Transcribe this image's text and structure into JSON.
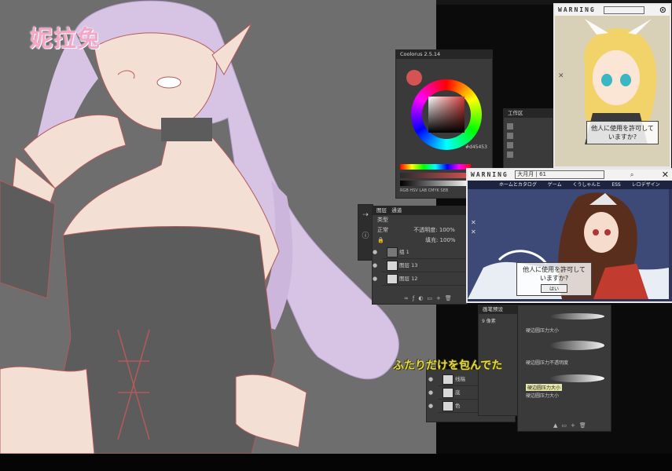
{
  "canvas": {
    "logo_text": "妮拉兔"
  },
  "color_panel": {
    "title": "Coolorus 2.5.14",
    "hex_value": "#d45453",
    "footer_items": [
      "RGB",
      "HSV",
      "LAB",
      "CMYK",
      "SEB"
    ]
  },
  "small_panel": {
    "title": "工作区"
  },
  "layers_panel": {
    "tabs": [
      "图层",
      "通道"
    ],
    "kind_label": "类型",
    "blend_mode": "正常",
    "opacity_label": "不透明度:",
    "opacity_value": "100%",
    "fill_label": "填充:",
    "fill_value": "100%",
    "layers": [
      {
        "name": "组 1"
      },
      {
        "name": "图层 13"
      },
      {
        "name": "图层 12"
      }
    ]
  },
  "lower_layers": {
    "layers": [
      {
        "name": "线稿"
      },
      {
        "name": "底"
      },
      {
        "name": "色"
      }
    ]
  },
  "warning_top": {
    "title": "WARNING",
    "field_text": "",
    "dialog_text": "他人に使用を許可していますか?"
  },
  "warning_main": {
    "title": "WARNING",
    "address": "大月月 | 61",
    "menu": [
      "ホームとカタログ",
      "ゲーム",
      "くうしゃんと",
      "ESS",
      "レロデザイン"
    ],
    "dialog_text": "他人に使用を許可していますか?",
    "ok_label": "はい"
  },
  "brush_panel": {
    "title": "画笔预设",
    "size_value": "9 像素",
    "items": [
      "硬边圆压力大小",
      "硬边圆压力不透明度",
      "硬边圆压力大小",
      "硬边圆压力大小"
    ]
  },
  "subtitle": {
    "text": "ふたりだけを包んでた"
  },
  "colors": {
    "logo": "#f4a6c6",
    "subtitle": "#e7da4a",
    "accent_red": "#d45453"
  }
}
